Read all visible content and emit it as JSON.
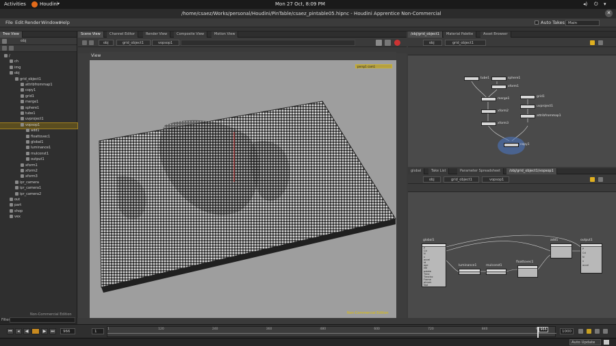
{
  "topbar": {
    "activities": "Activities",
    "app_name": "Houdini",
    "clock": "Mon 27 Oct,  8:09 PM"
  },
  "titlebar": {
    "title": "/home/csaez/Works/personal/Houdini/PinTable/csaez_pintable05.hipnc - Houdini Apprentice Non-Commercial"
  },
  "menu": {
    "items": [
      "File",
      "Edit",
      "Render",
      "Windows",
      "Help"
    ],
    "auto_takes": "Auto Takes",
    "take": "Main"
  },
  "tree_pane": {
    "tab": "Tree View",
    "path": "obj",
    "items": [
      {
        "label": "/",
        "depth": 0
      },
      {
        "label": "ch",
        "depth": 1
      },
      {
        "label": "img",
        "depth": 1
      },
      {
        "label": "obj",
        "depth": 1
      },
      {
        "label": "grid_object1",
        "depth": 2
      },
      {
        "label": "attribfrommap1",
        "depth": 3
      },
      {
        "label": "copy1",
        "depth": 3
      },
      {
        "label": "grid1",
        "depth": 3
      },
      {
        "label": "merge1",
        "depth": 3
      },
      {
        "label": "sphere1",
        "depth": 3
      },
      {
        "label": "tube1",
        "depth": 3
      },
      {
        "label": "uvproject1",
        "depth": 3
      },
      {
        "label": "vopsop1",
        "depth": 3
      },
      {
        "label": "add1",
        "depth": 4
      },
      {
        "label": "floattovec1",
        "depth": 4
      },
      {
        "label": "global1",
        "depth": 4
      },
      {
        "label": "luminance1",
        "depth": 4
      },
      {
        "label": "mulconst1",
        "depth": 4
      },
      {
        "label": "output1",
        "depth": 4
      },
      {
        "label": "xform1",
        "depth": 3
      },
      {
        "label": "xform2",
        "depth": 3
      },
      {
        "label": "xform3",
        "depth": 3
      },
      {
        "label": "ipr_camera",
        "depth": 2
      },
      {
        "label": "ipr_camera1",
        "depth": 2
      },
      {
        "label": "ipr_camera2",
        "depth": 2
      },
      {
        "label": "out",
        "depth": 1
      },
      {
        "label": "part",
        "depth": 1
      },
      {
        "label": "shop",
        "depth": 1
      },
      {
        "label": "vex",
        "depth": 1
      }
    ],
    "selected_index": 12,
    "footer": "Non-Commercial Edition",
    "filter_label": "Filter"
  },
  "center_pane": {
    "tabs": [
      "Scene View",
      "Channel Editor",
      "Render View",
      "Composite View",
      "Motion View"
    ],
    "path_obj": "obj",
    "path_node": "grid_object1",
    "path_sop": "vopsop1",
    "view_label": "View",
    "persp_badge": "persp1  cam1",
    "watermark": "Non-Commercial Edition"
  },
  "top_right_pane": {
    "tabs": [
      "/obj/grid_object1",
      "Material Palette",
      "Asset Browser"
    ],
    "path_obj": "obj",
    "path_node": "grid_object1",
    "nodes": [
      "tube1",
      "sphere1",
      "xform1",
      "merge1",
      "xform2",
      "grid1",
      "uvproject1",
      "attribfrommap1",
      "xform3",
      "copy1"
    ]
  },
  "bottom_right_pane": {
    "tabs": [
      "global",
      "Take List",
      "Parameter Spreadsheet",
      "/obj/grid_object1/vopsop1"
    ],
    "path_obj": "obj",
    "path_node": "grid_object1",
    "path_sop": "vopsop1",
    "nodes": {
      "global": "global1",
      "luminance": "luminance1",
      "mulconst": "mulconst1",
      "floattovec": "floattovec1",
      "add": "add1",
      "output": "output1"
    },
    "global_ports": [
      "P",
      "Cd",
      "N",
      "v",
      "accel",
      "id",
      "age",
      "life",
      "pstate",
      "Time",
      "TimeInc",
      "Frame",
      "ptnum",
      "Npt"
    ],
    "output_ports": [
      "P",
      "Cd",
      "N",
      "v",
      "accel"
    ]
  },
  "timeline": {
    "current_frame": "966",
    "start_frame": "1",
    "end_frame": "1000",
    "marker_value": "966",
    "ticks": [
      "1",
      "120",
      "240",
      "360",
      "480",
      "600",
      "720",
      "840",
      "960"
    ],
    "auto_update": "Auto Update"
  },
  "colors": {
    "selection": "#f0c000",
    "viewport_bg": "#9e9e9e",
    "net_bg": "#4a4a4a",
    "copy_node_ring": "#4a78c8"
  }
}
